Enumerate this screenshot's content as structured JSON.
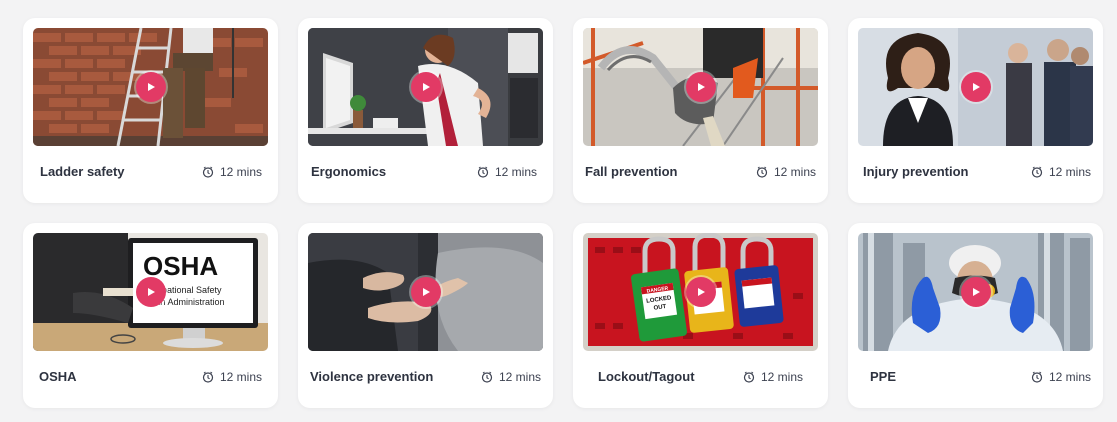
{
  "colors": {
    "accent": "#e23a65",
    "page_background": "#f3f3f4",
    "card_background": "#ffffff",
    "title_text": "#2e3340"
  },
  "courses": [
    {
      "title": "Ladder safety",
      "duration": "12 mins",
      "thumbnail": "worker-on-ladder-brick-wall"
    },
    {
      "title": "Ergonomics",
      "duration": "12 mins",
      "thumbnail": "woman-back-pain-at-desk"
    },
    {
      "title": "Fall prevention",
      "duration": "12 mins",
      "thumbnail": "harness-hook-scaffold"
    },
    {
      "title": "Injury prevention",
      "duration": "12 mins",
      "thumbnail": "businesswoman-smiling-team"
    },
    {
      "title": "OSHA",
      "duration": "12 mins",
      "thumbnail": "osha-monitor",
      "thumbnail_text": [
        "OSHA",
        "ccupational Safety",
        "alth Administration"
      ]
    },
    {
      "title": "Violence prevention",
      "duration": "12 mins",
      "thumbnail": "hands-gesturing-argument"
    },
    {
      "title": "Lockout/Tagout",
      "duration": "12 mins",
      "thumbnail": "lockout-padlocks",
      "thumbnail_text": [
        "DANGER",
        "LOCKED",
        "OUT"
      ]
    },
    {
      "title": "PPE",
      "duration": "12 mins",
      "thumbnail": "worker-mask-thumbs-up"
    }
  ]
}
